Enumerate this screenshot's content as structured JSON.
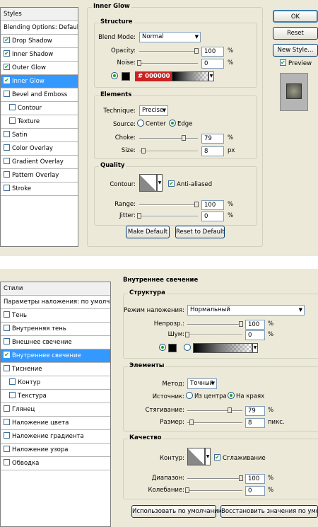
{
  "en": {
    "styles_header": "Styles",
    "blending": "Blending Options: Default",
    "items": [
      {
        "label": "Drop Shadow",
        "checked": true
      },
      {
        "label": "Inner Shadow",
        "checked": true
      },
      {
        "label": "Outer Glow",
        "checked": true
      },
      {
        "label": "Inner Glow",
        "checked": true
      },
      {
        "label": "Bevel and Emboss",
        "checked": false
      },
      {
        "label": "Contour",
        "checked": false
      },
      {
        "label": "Texture",
        "checked": false
      },
      {
        "label": "Satin",
        "checked": false
      },
      {
        "label": "Color Overlay",
        "checked": false
      },
      {
        "label": "Gradient Overlay",
        "checked": false
      },
      {
        "label": "Pattern Overlay",
        "checked": false
      },
      {
        "label": "Stroke",
        "checked": false
      }
    ],
    "section_title": "Inner Glow",
    "structure": "Structure",
    "blend_mode_label": "Blend Mode:",
    "blend_mode": "Normal",
    "opacity_label": "Opacity:",
    "opacity": "100",
    "noise_label": "Noise:",
    "noise": "0",
    "pct": "%",
    "color_hex": "# 000000",
    "elements": "Elements",
    "technique_label": "Technique:",
    "technique": "Precise",
    "source_label": "Source:",
    "center": "Center",
    "edge": "Edge",
    "choke_label": "Choke:",
    "choke": "79",
    "size_label": "Size:",
    "size": "8",
    "px": "px",
    "quality": "Quality",
    "contour_label": "Contour:",
    "anti_aliased": "Anti-aliased",
    "range_label": "Range:",
    "range": "100",
    "jitter_label": "Jitter:",
    "jitter": "0",
    "make_default": "Make Default",
    "reset_default": "Reset to Default",
    "ok": "OK",
    "reset": "Reset",
    "new_style": "New Style...",
    "preview": "Preview"
  },
  "ru": {
    "styles_header": "Стили",
    "blending": "Параметры наложения: по умолчанию",
    "items": [
      {
        "label": "Тень",
        "checked": false
      },
      {
        "label": "Внутренняя тень",
        "checked": false
      },
      {
        "label": "Внешнее свечение",
        "checked": false
      },
      {
        "label": "Внутреннее свечение",
        "checked": true
      },
      {
        "label": "Тиснение",
        "checked": false
      },
      {
        "label": "Контур",
        "checked": false
      },
      {
        "label": "Текстура",
        "checked": false
      },
      {
        "label": "Глянец",
        "checked": false
      },
      {
        "label": "Наложение цвета",
        "checked": false
      },
      {
        "label": "Наложение градиента",
        "checked": false
      },
      {
        "label": "Наложение узора",
        "checked": false
      },
      {
        "label": "Обводка",
        "checked": false
      }
    ],
    "section_title": "Внутреннее свечение",
    "structure": "Структура",
    "blend_mode_label": "Режим наложения:",
    "blend_mode": "Нормальный",
    "opacity_label": "Непрозр.:",
    "opacity": "100",
    "noise_label": "Шум:",
    "noise": "0",
    "pct": "%",
    "elements": "Элементы",
    "technique_label": "Метод:",
    "technique": "Точный",
    "source_label": "Источник:",
    "center": "Из центра",
    "edge": "На краях",
    "choke_label": "Стягивание:",
    "choke": "79",
    "size_label": "Размер:",
    "size": "8",
    "px": "пикс.",
    "quality": "Качество",
    "contour_label": "Контур:",
    "anti_aliased": "Сглаживание",
    "range_label": "Диапазон:",
    "range": "100",
    "jitter_label": "Колебание:",
    "jitter": "0",
    "make_default": "Использовать по умолчанию",
    "reset_default": "Восстановить значения по умолчанию"
  }
}
